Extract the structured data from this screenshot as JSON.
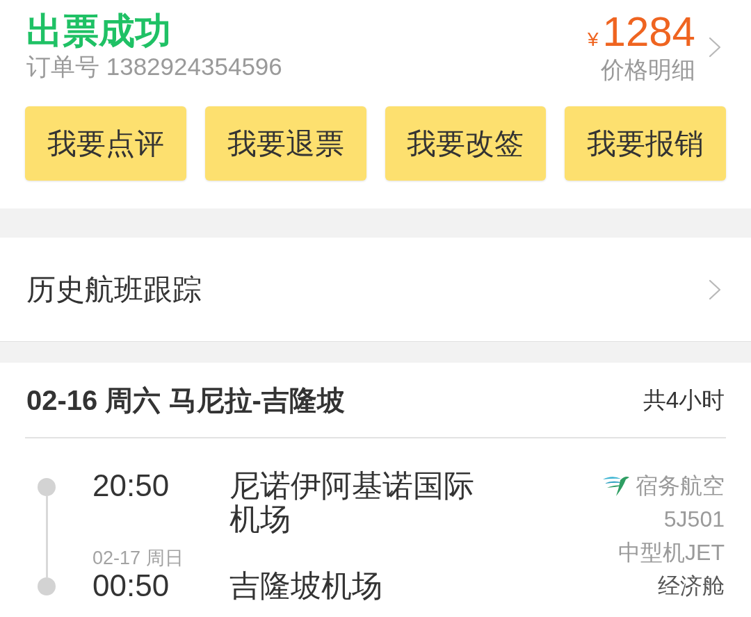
{
  "header": {
    "status": "出票成功",
    "order_number": "订单号 1382924354596",
    "price": {
      "currency": "¥",
      "amount": "1284",
      "detail_link": "价格明细"
    }
  },
  "actions": [
    {
      "label": "我要点评"
    },
    {
      "label": "我要退票"
    },
    {
      "label": "我要改签"
    },
    {
      "label": "我要报销"
    }
  ],
  "history_link": {
    "label": "历史航班跟踪"
  },
  "trip": {
    "title": "02-16 周六 马尼拉-吉隆坡",
    "duration": "共4小时",
    "departure": {
      "time": "20:50",
      "airport": "尼诺伊阿基诺国际机场"
    },
    "arrival": {
      "date": "02-17 周日",
      "time": "00:50",
      "airport": "吉隆坡机场"
    },
    "flight": {
      "airline": "宿务航空",
      "number": "5J501",
      "aircraft": "中型机JET",
      "cabin": "经济舱"
    }
  }
}
